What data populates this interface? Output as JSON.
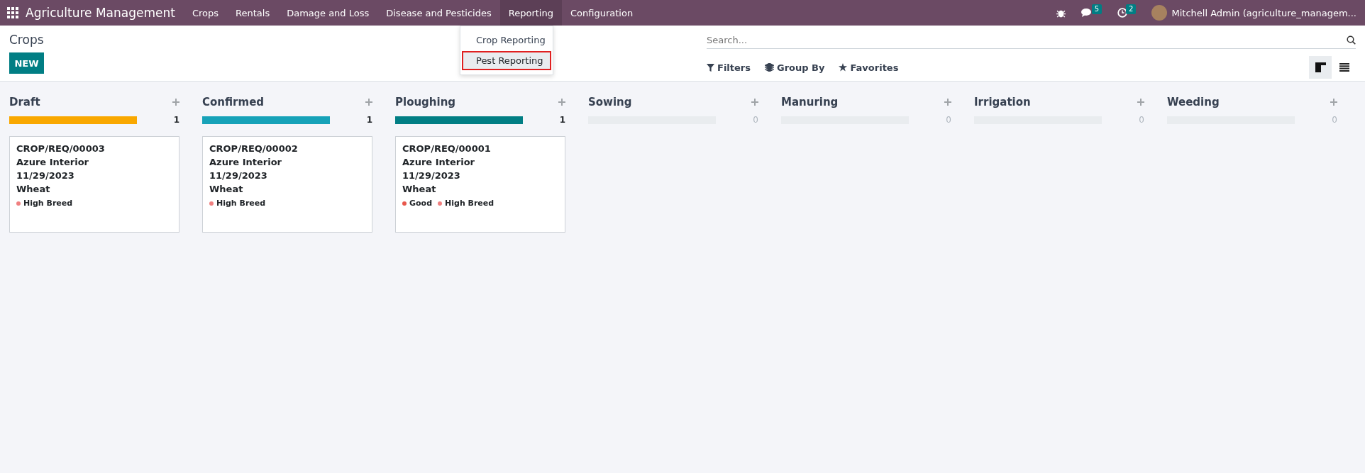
{
  "navbar": {
    "app_name": "Agriculture Management",
    "menu": [
      {
        "label": "Crops",
        "selected": false
      },
      {
        "label": "Rentals",
        "selected": false
      },
      {
        "label": "Damage and Loss",
        "selected": false
      },
      {
        "label": "Disease and Pesticides",
        "selected": false
      },
      {
        "label": "Reporting",
        "selected": true
      },
      {
        "label": "Configuration",
        "selected": false
      }
    ],
    "messages_count": "5",
    "activities_count": "2",
    "user": "Mitchell Admin (agriculture_managem..."
  },
  "dropdown": {
    "items": [
      {
        "label": "Crop Reporting",
        "selected": false
      },
      {
        "label": "Pest Reporting",
        "selected": true
      }
    ]
  },
  "control_panel": {
    "title": "Crops",
    "new_button": "NEW",
    "search": {
      "placeholder": "Search..."
    },
    "filters": [
      "Filters",
      "Group By",
      "Favorites"
    ],
    "views": [
      {
        "kind": "kanban",
        "selected": true
      },
      {
        "kind": "list",
        "selected": false
      }
    ]
  },
  "columns": [
    {
      "name": "Draft",
      "count": "1",
      "level": 1,
      "color": "#f9a800",
      "cards": [
        {
          "reference": "CROP/REQ/00003",
          "customer": "Azure Interior",
          "date": "11/29/2023",
          "crop": "Wheat",
          "tags": [
            {
              "label": "High Breed",
              "color": "#f08080"
            }
          ]
        }
      ]
    },
    {
      "name": "Confirmed",
      "count": "1",
      "level": 1,
      "color": "#17a2b8",
      "cards": [
        {
          "reference": "CROP/REQ/00002",
          "customer": "Azure Interior",
          "date": "11/29/2023",
          "crop": "Wheat",
          "tags": [
            {
              "label": "High Breed",
              "color": "#f08080"
            }
          ]
        }
      ]
    },
    {
      "name": "Ploughing",
      "count": "1",
      "level": 1,
      "color": "#017e84",
      "cards": [
        {
          "reference": "CROP/REQ/00001",
          "customer": "Azure Interior",
          "date": "11/29/2023",
          "crop": "Wheat",
          "tags": [
            {
              "label": "Good",
              "color": "#e8574c"
            },
            {
              "label": "High Breed",
              "color": "#f08080"
            }
          ]
        }
      ]
    },
    {
      "name": "Sowing",
      "count": "0",
      "level": 0
    },
    {
      "name": "Manuring",
      "count": "0",
      "level": 0
    },
    {
      "name": "Irrigation",
      "count": "0",
      "level": 0
    },
    {
      "name": "Weeding",
      "count": "0",
      "level": 0
    }
  ]
}
